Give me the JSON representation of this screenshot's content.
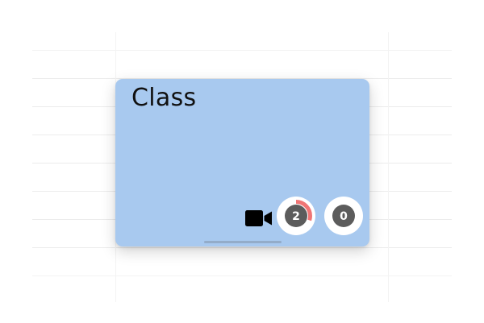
{
  "event": {
    "title": "Class",
    "background_color": "#a8c9ef",
    "video_icon": "video-camera-icon"
  },
  "counters": [
    {
      "value": "2",
      "ring_color": "#f07575",
      "progress_fraction": 0.3
    },
    {
      "value": "0",
      "ring_color": "#f07575",
      "progress_fraction": 0
    }
  ],
  "colors": {
    "counter_fill": "#5c5c5c",
    "counter_text": "#ffffff",
    "counter_border": "#ffffff"
  }
}
